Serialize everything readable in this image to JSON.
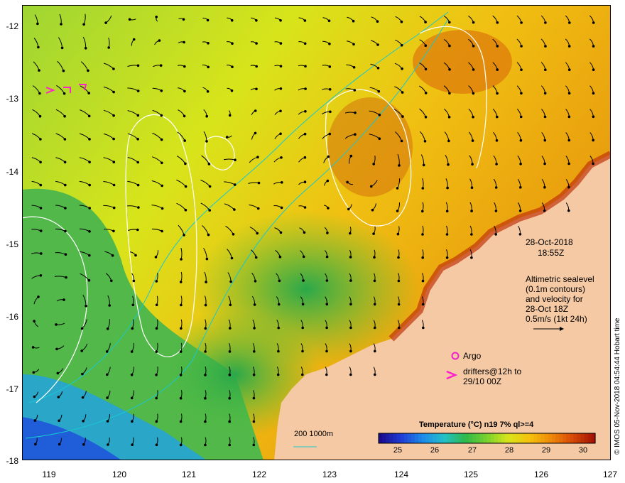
{
  "map": {
    "lat_ticks": [
      "-12",
      "-13",
      "-14",
      "-15",
      "-16",
      "-17",
      "-18"
    ],
    "lon_ticks": [
      "119",
      "120",
      "121",
      "122",
      "123",
      "124",
      "125",
      "126",
      "127"
    ],
    "date": "28-Oct-2018",
    "time": "18:55Z",
    "altimetry_note": [
      "Altimetric sealevel",
      "(0.1m contours)",
      "and velocity for",
      "28-Oct 18Z",
      "0.5m/s (1kt 24h)"
    ],
    "argo_label": "Argo",
    "drifter_label_1": "drifters@12h to",
    "drifter_label_2": "29/10 00Z",
    "bathy_label": "200  1000m",
    "colorbar_title": "Temperature (°C) n19 7% ql>=4",
    "colorbar_ticks": [
      "25",
      "26",
      "27",
      "28",
      "29",
      "30"
    ],
    "credit": "© IMOS 05-Nov-2018 04:54:44 Hobart time",
    "colors": {
      "land": "#f5c9a4",
      "cyan_contour": "#19c8d0",
      "sea_level_contour": "#ffffff",
      "drifter": "#ff22cc",
      "argo": "#ee22cc"
    },
    "colorbar_stops": [
      "#1a0a8c",
      "#1f3ed6",
      "#1e8be8",
      "#23c1c8",
      "#2fb84a",
      "#7ad22e",
      "#d8e41a",
      "#f4c20c",
      "#ee8a0a",
      "#d84a08",
      "#a41404"
    ]
  }
}
